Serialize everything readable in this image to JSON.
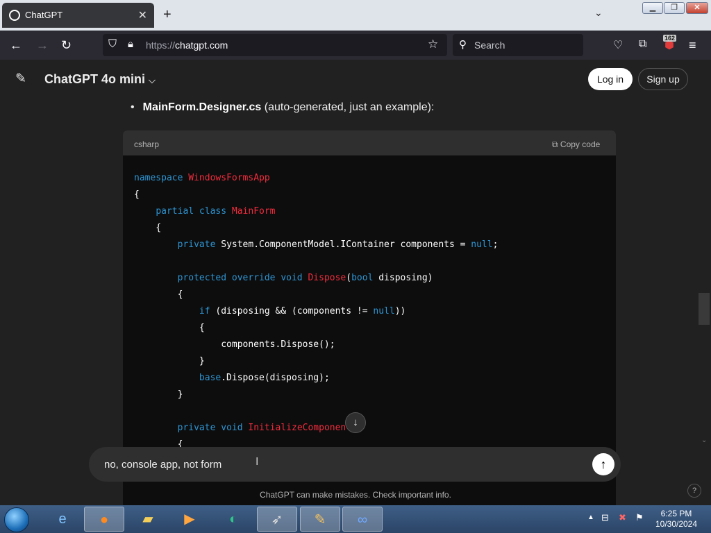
{
  "browser": {
    "tab_title": "ChatGPT",
    "url_scheme": "https://",
    "url_host": "chatgpt.com",
    "search_placeholder": "Search",
    "extension_badge": "162"
  },
  "header": {
    "model_name": "ChatGPT 4o mini",
    "login_label": "Log in",
    "signup_label": "Sign up"
  },
  "content": {
    "bullet_bold": "MainForm.Designer.cs",
    "bullet_rest": " (auto-generated, just an example):"
  },
  "codeblock": {
    "language": "csharp",
    "copy_label": "Copy code",
    "lines": [
      [
        [
          "kw",
          "namespace "
        ],
        [
          "ty",
          "WindowsFormsApp"
        ]
      ],
      [
        [
          "",
          "{"
        ]
      ],
      [
        [
          "",
          "    "
        ],
        [
          "kw",
          "partial class "
        ],
        [
          "ty",
          "MainForm"
        ]
      ],
      [
        [
          "",
          "    {"
        ]
      ],
      [
        [
          "",
          "        "
        ],
        [
          "kw",
          "private "
        ],
        [
          "",
          "System.ComponentModel.IContainer components = "
        ],
        [
          "kw",
          "null"
        ],
        [
          "",
          ";"
        ]
      ],
      [
        [
          "",
          ""
        ]
      ],
      [
        [
          "",
          "        "
        ],
        [
          "kw",
          "protected override void "
        ],
        [
          "ty",
          "Dispose"
        ],
        [
          "",
          "("
        ],
        [
          "kw",
          "bool"
        ],
        [
          "",
          " disposing)"
        ]
      ],
      [
        [
          "",
          "        {"
        ]
      ],
      [
        [
          "",
          "            "
        ],
        [
          "kw",
          "if"
        ],
        [
          "",
          " (disposing && (components != "
        ],
        [
          "kw",
          "null"
        ],
        [
          "",
          "))"
        ]
      ],
      [
        [
          "",
          "            {"
        ]
      ],
      [
        [
          "",
          "                components.Dispose();"
        ]
      ],
      [
        [
          "",
          "            }"
        ]
      ],
      [
        [
          "",
          "            "
        ],
        [
          "kw",
          "base"
        ],
        [
          "",
          ".Dispose(disposing);"
        ]
      ],
      [
        [
          "",
          "        }"
        ]
      ],
      [
        [
          "",
          ""
        ]
      ],
      [
        [
          "",
          "        "
        ],
        [
          "kw",
          "private void "
        ],
        [
          "ty",
          "InitializeComponent"
        ],
        [
          "",
          "()"
        ]
      ],
      [
        [
          "",
          "        {"
        ]
      ]
    ]
  },
  "composer": {
    "value": "no, console app, not form"
  },
  "footer": {
    "disclaimer": "ChatGPT can make mistakes. Check important info."
  },
  "taskbar": {
    "time": "6:25 PM",
    "date": "10/30/2024"
  }
}
